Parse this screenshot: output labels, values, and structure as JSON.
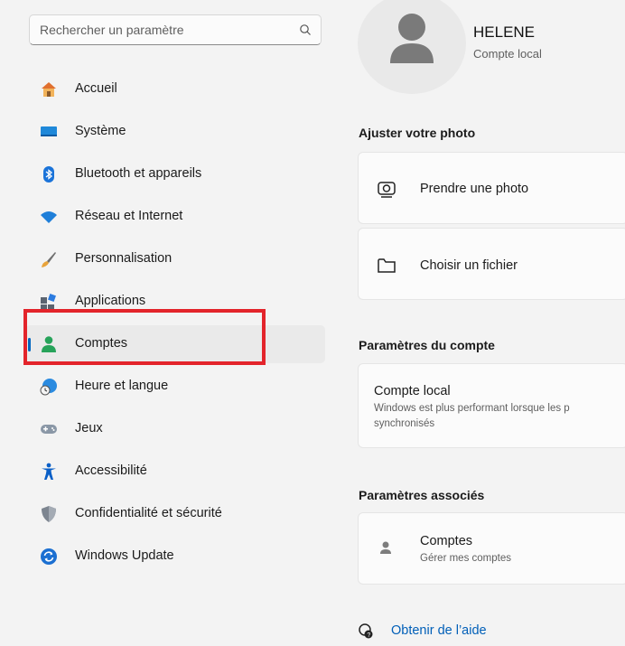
{
  "search": {
    "placeholder": "Rechercher un paramètre"
  },
  "sidebar": {
    "items": [
      {
        "label": "Accueil",
        "icon": "home-icon"
      },
      {
        "label": "Système",
        "icon": "monitor-icon"
      },
      {
        "label": "Bluetooth et appareils",
        "icon": "bluetooth-icon"
      },
      {
        "label": "Réseau et Internet",
        "icon": "wifi-icon"
      },
      {
        "label": "Personnalisation",
        "icon": "brush-icon"
      },
      {
        "label": "Applications",
        "icon": "apps-icon"
      },
      {
        "label": "Comptes",
        "icon": "person-icon",
        "selected": true
      },
      {
        "label": "Heure et langue",
        "icon": "clock-globe-icon"
      },
      {
        "label": "Jeux",
        "icon": "gamepad-icon"
      },
      {
        "label": "Accessibilité",
        "icon": "accessibility-icon"
      },
      {
        "label": "Confidentialité et sécurité",
        "icon": "shield-icon"
      },
      {
        "label": "Windows Update",
        "icon": "update-icon"
      }
    ]
  },
  "profile": {
    "name": "HELENE",
    "type": "Compte local"
  },
  "photo_section": {
    "title": "Ajuster votre photo",
    "take_photo": "Prendre une photo",
    "choose_file": "Choisir un fichier"
  },
  "account_settings": {
    "title": "Paramètres du compte",
    "local_account_title": "Compte local",
    "local_account_desc_1": "Windows est plus performant lorsque les p",
    "local_account_desc_2": "synchronisés"
  },
  "related": {
    "title": "Paramètres associés",
    "accounts_title": "Comptes",
    "accounts_sub": "Gérer mes comptes"
  },
  "help": {
    "label": "Obtenir de l’aide"
  },
  "colors": {
    "accent": "#0067c0",
    "highlight": "#e3242b",
    "link": "#005fb8"
  }
}
